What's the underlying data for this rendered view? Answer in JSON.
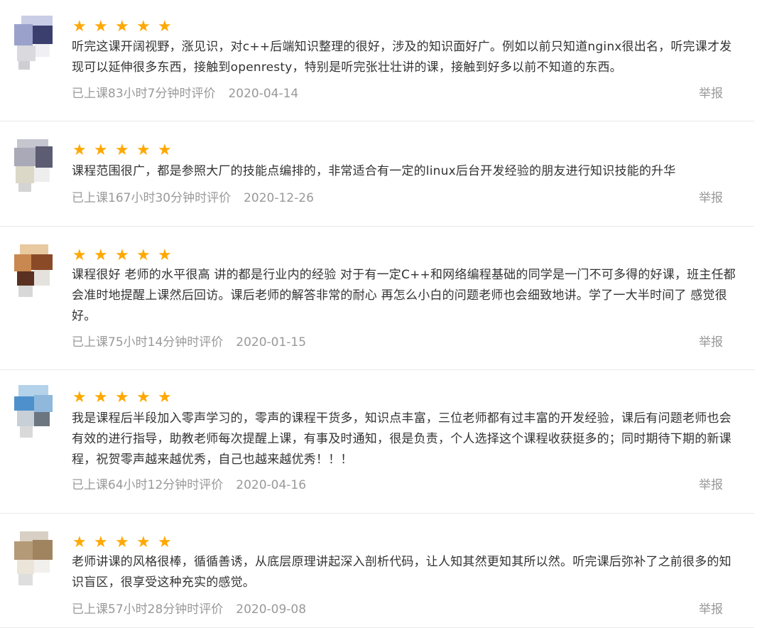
{
  "reviews": [
    {
      "stars": 5,
      "text": "听完这课开阔视野，涨见识，对c++后端知识整理的很好，涉及的知识面好广。例如以前只知道nginx很出名，听完课才发现可以延伸很多东西，接触到openresty，特别是听完张壮壮讲的课，接触到好多以前不知道的东西。",
      "study_time": "已上课83小时7分钟时评价",
      "date": "2020-04-14",
      "report": "举报"
    },
    {
      "stars": 5,
      "text": "课程范围很广，都是参照大厂的技能点编排的，非常适合有一定的linux后台开发经验的朋友进行知识技能的升华",
      "study_time": "已上课167小时30分钟时评价",
      "date": "2020-12-26",
      "report": "举报"
    },
    {
      "stars": 5,
      "text": "课程很好 老师的水平很高 讲的都是行业内的经验 对于有一定C++和网络编程基础的同学是一门不可多得的好课，班主任都会准时地提醒上课然后回访。课后老师的解答非常的耐心 再怎么小白的问题老师也会细致地讲。学了一大半时间了 感觉很好。",
      "study_time": "已上课75小时14分钟时评价",
      "date": "2020-01-15",
      "report": "举报"
    },
    {
      "stars": 5,
      "text": "我是课程后半段加入零声学习的，零声的课程干货多，知识点丰富，三位老师都有过丰富的开发经验，课后有问题老师也会有效的进行指导，助教老师每次提醒上课，有事及时通知，很是负责，个人选择这个课程收获挺多的；同时期待下期的新课程，祝贺零声越来越优秀，自己也越来越优秀！！！",
      "study_time": "已上课64小时12分钟时评价",
      "date": "2020-04-16",
      "report": "举报"
    },
    {
      "stars": 5,
      "text": "老师讲课的风格很棒，循循善诱，从底层原理讲起深入剖析代码，让人知其然更知其所以然。听完课后弥补了之前很多的知识盲区，很享受这种充实的感觉。",
      "study_time": "已上课57小时28分钟时评价",
      "date": "2020-09-08",
      "report": "举报"
    }
  ],
  "colors": {
    "star": "#ffa800",
    "text": "#333333",
    "meta": "#999999",
    "divider": "#e8e8e8"
  },
  "icons": {
    "star": "star-icon",
    "avatar": "blurred-avatar-image"
  }
}
